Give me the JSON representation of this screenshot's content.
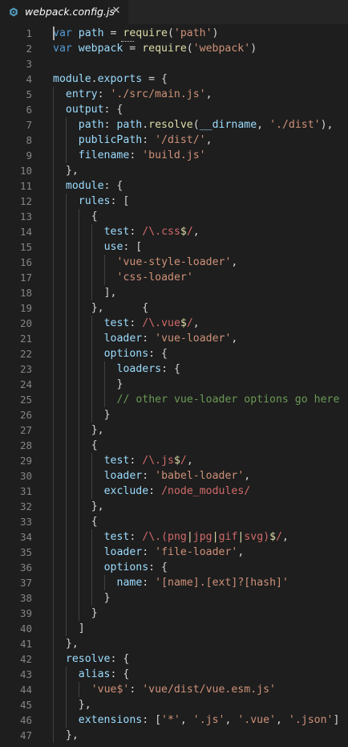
{
  "tab": {
    "title": "webpack.config.js",
    "close_glyph": "✕",
    "icon": "gear-file-icon",
    "icon_color": "#519aba"
  },
  "colors": {
    "background": "#1e1e1e",
    "keyword": "#569cd6",
    "property": "#9cdcfe",
    "function": "#dcdcaa",
    "string": "#ce9178",
    "regex": "#d16969",
    "comment": "#6a9955",
    "line_number": "#858585"
  },
  "lines": [
    {
      "n": "1",
      "indent": 0,
      "tokens": [
        [
          "k",
          "var"
        ],
        [
          "p",
          " "
        ],
        [
          "v",
          "path"
        ],
        [
          "p",
          " = "
        ],
        [
          "f",
          "require"
        ],
        [
          "p",
          "("
        ],
        [
          "s",
          "'path'"
        ],
        [
          "p",
          ")"
        ]
      ]
    },
    {
      "n": "2",
      "indent": 0,
      "tokens": [
        [
          "k",
          "var"
        ],
        [
          "p",
          " "
        ],
        [
          "v",
          "webpack"
        ],
        [
          "p",
          " = "
        ],
        [
          "f",
          "require"
        ],
        [
          "p",
          "("
        ],
        [
          "s",
          "'webpack'"
        ],
        [
          "p",
          ")"
        ]
      ]
    },
    {
      "n": "3",
      "indent": 0,
      "tokens": []
    },
    {
      "n": "4",
      "indent": 0,
      "tokens": [
        [
          "v",
          "module"
        ],
        [
          "p",
          "."
        ],
        [
          "v",
          "exports"
        ],
        [
          "p",
          " = {"
        ]
      ]
    },
    {
      "n": "5",
      "indent": 1,
      "tokens": [
        [
          "v",
          "entry"
        ],
        [
          "p",
          ": "
        ],
        [
          "s",
          "'./src/main.js'"
        ],
        [
          "p",
          ","
        ]
      ]
    },
    {
      "n": "6",
      "indent": 1,
      "tokens": [
        [
          "v",
          "output"
        ],
        [
          "p",
          ": {"
        ]
      ]
    },
    {
      "n": "7",
      "indent": 2,
      "tokens": [
        [
          "v",
          "path"
        ],
        [
          "p",
          ": "
        ],
        [
          "v",
          "path"
        ],
        [
          "p",
          "."
        ],
        [
          "f",
          "resolve"
        ],
        [
          "p",
          "("
        ],
        [
          "v",
          "__dirname"
        ],
        [
          "p",
          ", "
        ],
        [
          "s",
          "'./dist'"
        ],
        [
          "p",
          "),"
        ]
      ]
    },
    {
      "n": "8",
      "indent": 2,
      "tokens": [
        [
          "v",
          "publicPath"
        ],
        [
          "p",
          ": "
        ],
        [
          "s",
          "'/dist/'"
        ],
        [
          "p",
          ","
        ]
      ]
    },
    {
      "n": "9",
      "indent": 2,
      "tokens": [
        [
          "v",
          "filename"
        ],
        [
          "p",
          ": "
        ],
        [
          "s",
          "'build.js'"
        ]
      ]
    },
    {
      "n": "10",
      "indent": 1,
      "tokens": [
        [
          "p",
          "},"
        ]
      ]
    },
    {
      "n": "11",
      "indent": 1,
      "tokens": [
        [
          "v",
          "module"
        ],
        [
          "p",
          ": {"
        ]
      ]
    },
    {
      "n": "12",
      "indent": 2,
      "tokens": [
        [
          "v",
          "rules"
        ],
        [
          "p",
          ": ["
        ]
      ]
    },
    {
      "n": "13",
      "indent": 3,
      "tokens": [
        [
          "p",
          "{"
        ]
      ]
    },
    {
      "n": "14",
      "indent": 4,
      "tokens": [
        [
          "v",
          "test"
        ],
        [
          "p",
          ": "
        ],
        [
          "r",
          "/\\.css"
        ],
        [
          "e",
          "$"
        ],
        [
          "r",
          "/"
        ],
        [
          "p",
          ","
        ]
      ]
    },
    {
      "n": "15",
      "indent": 4,
      "tokens": [
        [
          "v",
          "use"
        ],
        [
          "p",
          ": ["
        ]
      ]
    },
    {
      "n": "16",
      "indent": 5,
      "tokens": [
        [
          "s",
          "'vue-style-loader'"
        ],
        [
          "p",
          ","
        ]
      ]
    },
    {
      "n": "17",
      "indent": 5,
      "tokens": [
        [
          "s",
          "'css-loader'"
        ]
      ]
    },
    {
      "n": "18",
      "indent": 4,
      "tokens": [
        [
          "p",
          "],"
        ]
      ]
    },
    {
      "n": "19",
      "indent": 3,
      "tokens": [
        [
          "p",
          "},      {"
        ]
      ]
    },
    {
      "n": "20",
      "indent": 4,
      "tokens": [
        [
          "v",
          "test"
        ],
        [
          "p",
          ": "
        ],
        [
          "r",
          "/\\.vue"
        ],
        [
          "e",
          "$"
        ],
        [
          "r",
          "/"
        ],
        [
          "p",
          ","
        ]
      ]
    },
    {
      "n": "21",
      "indent": 4,
      "tokens": [
        [
          "v",
          "loader"
        ],
        [
          "p",
          ": "
        ],
        [
          "s",
          "'vue-loader'"
        ],
        [
          "p",
          ","
        ]
      ]
    },
    {
      "n": "22",
      "indent": 4,
      "tokens": [
        [
          "v",
          "options"
        ],
        [
          "p",
          ": {"
        ]
      ]
    },
    {
      "n": "23",
      "indent": 5,
      "tokens": [
        [
          "v",
          "loaders"
        ],
        [
          "p",
          ": {"
        ]
      ]
    },
    {
      "n": "24",
      "indent": 5,
      "tokens": [
        [
          "p",
          "}"
        ]
      ]
    },
    {
      "n": "25",
      "indent": 5,
      "tokens": [
        [
          "c",
          "// other vue-loader options go here"
        ]
      ]
    },
    {
      "n": "26",
      "indent": 4,
      "tokens": [
        [
          "p",
          "}"
        ]
      ]
    },
    {
      "n": "27",
      "indent": 3,
      "tokens": [
        [
          "p",
          "},"
        ]
      ]
    },
    {
      "n": "28",
      "indent": 3,
      "tokens": [
        [
          "p",
          "{"
        ]
      ]
    },
    {
      "n": "29",
      "indent": 4,
      "tokens": [
        [
          "v",
          "test"
        ],
        [
          "p",
          ": "
        ],
        [
          "r",
          "/\\.js"
        ],
        [
          "e",
          "$"
        ],
        [
          "r",
          "/"
        ],
        [
          "p",
          ","
        ]
      ]
    },
    {
      "n": "30",
      "indent": 4,
      "tokens": [
        [
          "v",
          "loader"
        ],
        [
          "p",
          ": "
        ],
        [
          "s",
          "'babel-loader'"
        ],
        [
          "p",
          ","
        ]
      ]
    },
    {
      "n": "31",
      "indent": 4,
      "tokens": [
        [
          "v",
          "exclude"
        ],
        [
          "p",
          ": "
        ],
        [
          "r",
          "/node_modules/"
        ]
      ]
    },
    {
      "n": "32",
      "indent": 3,
      "tokens": [
        [
          "p",
          "},"
        ]
      ]
    },
    {
      "n": "33",
      "indent": 3,
      "tokens": [
        [
          "p",
          "{"
        ]
      ]
    },
    {
      "n": "34",
      "indent": 4,
      "tokens": [
        [
          "v",
          "test"
        ],
        [
          "p",
          ": "
        ],
        [
          "r",
          "/\\.("
        ],
        [
          "r",
          "png"
        ],
        [
          "e",
          "|"
        ],
        [
          "r",
          "jpg"
        ],
        [
          "e",
          "|"
        ],
        [
          "r",
          "gif"
        ],
        [
          "e",
          "|"
        ],
        [
          "r",
          "svg"
        ],
        [
          "r",
          ")"
        ],
        [
          "e",
          "$"
        ],
        [
          "r",
          "/"
        ],
        [
          "p",
          ","
        ]
      ]
    },
    {
      "n": "35",
      "indent": 4,
      "tokens": [
        [
          "v",
          "loader"
        ],
        [
          "p",
          ": "
        ],
        [
          "s",
          "'file-loader'"
        ],
        [
          "p",
          ","
        ]
      ]
    },
    {
      "n": "36",
      "indent": 4,
      "tokens": [
        [
          "v",
          "options"
        ],
        [
          "p",
          ": {"
        ]
      ]
    },
    {
      "n": "37",
      "indent": 5,
      "tokens": [
        [
          "v",
          "name"
        ],
        [
          "p",
          ": "
        ],
        [
          "s",
          "'[name].[ext]?[hash]'"
        ]
      ]
    },
    {
      "n": "38",
      "indent": 4,
      "tokens": [
        [
          "p",
          "}"
        ]
      ]
    },
    {
      "n": "39",
      "indent": 3,
      "tokens": [
        [
          "p",
          "}"
        ]
      ]
    },
    {
      "n": "40",
      "indent": 2,
      "tokens": [
        [
          "p",
          "]"
        ]
      ]
    },
    {
      "n": "41",
      "indent": 1,
      "tokens": [
        [
          "p",
          "},"
        ]
      ]
    },
    {
      "n": "42",
      "indent": 1,
      "tokens": [
        [
          "v",
          "resolve"
        ],
        [
          "p",
          ": {"
        ]
      ]
    },
    {
      "n": "43",
      "indent": 2,
      "tokens": [
        [
          "v",
          "alias"
        ],
        [
          "p",
          ": {"
        ]
      ]
    },
    {
      "n": "44",
      "indent": 3,
      "tokens": [
        [
          "s",
          "'vue$'"
        ],
        [
          "p",
          ": "
        ],
        [
          "s",
          "'vue/dist/vue.esm.js'"
        ]
      ]
    },
    {
      "n": "45",
      "indent": 2,
      "tokens": [
        [
          "p",
          "},"
        ]
      ]
    },
    {
      "n": "46",
      "indent": 2,
      "tokens": [
        [
          "v",
          "extensions"
        ],
        [
          "p",
          ": ["
        ],
        [
          "s",
          "'*'"
        ],
        [
          "p",
          ", "
        ],
        [
          "s",
          "'.js'"
        ],
        [
          "p",
          ", "
        ],
        [
          "s",
          "'.vue'"
        ],
        [
          "p",
          ", "
        ],
        [
          "s",
          "'.json'"
        ],
        [
          "p",
          "]"
        ]
      ]
    },
    {
      "n": "47",
      "indent": 1,
      "tokens": [
        [
          "p",
          "},"
        ]
      ]
    }
  ]
}
